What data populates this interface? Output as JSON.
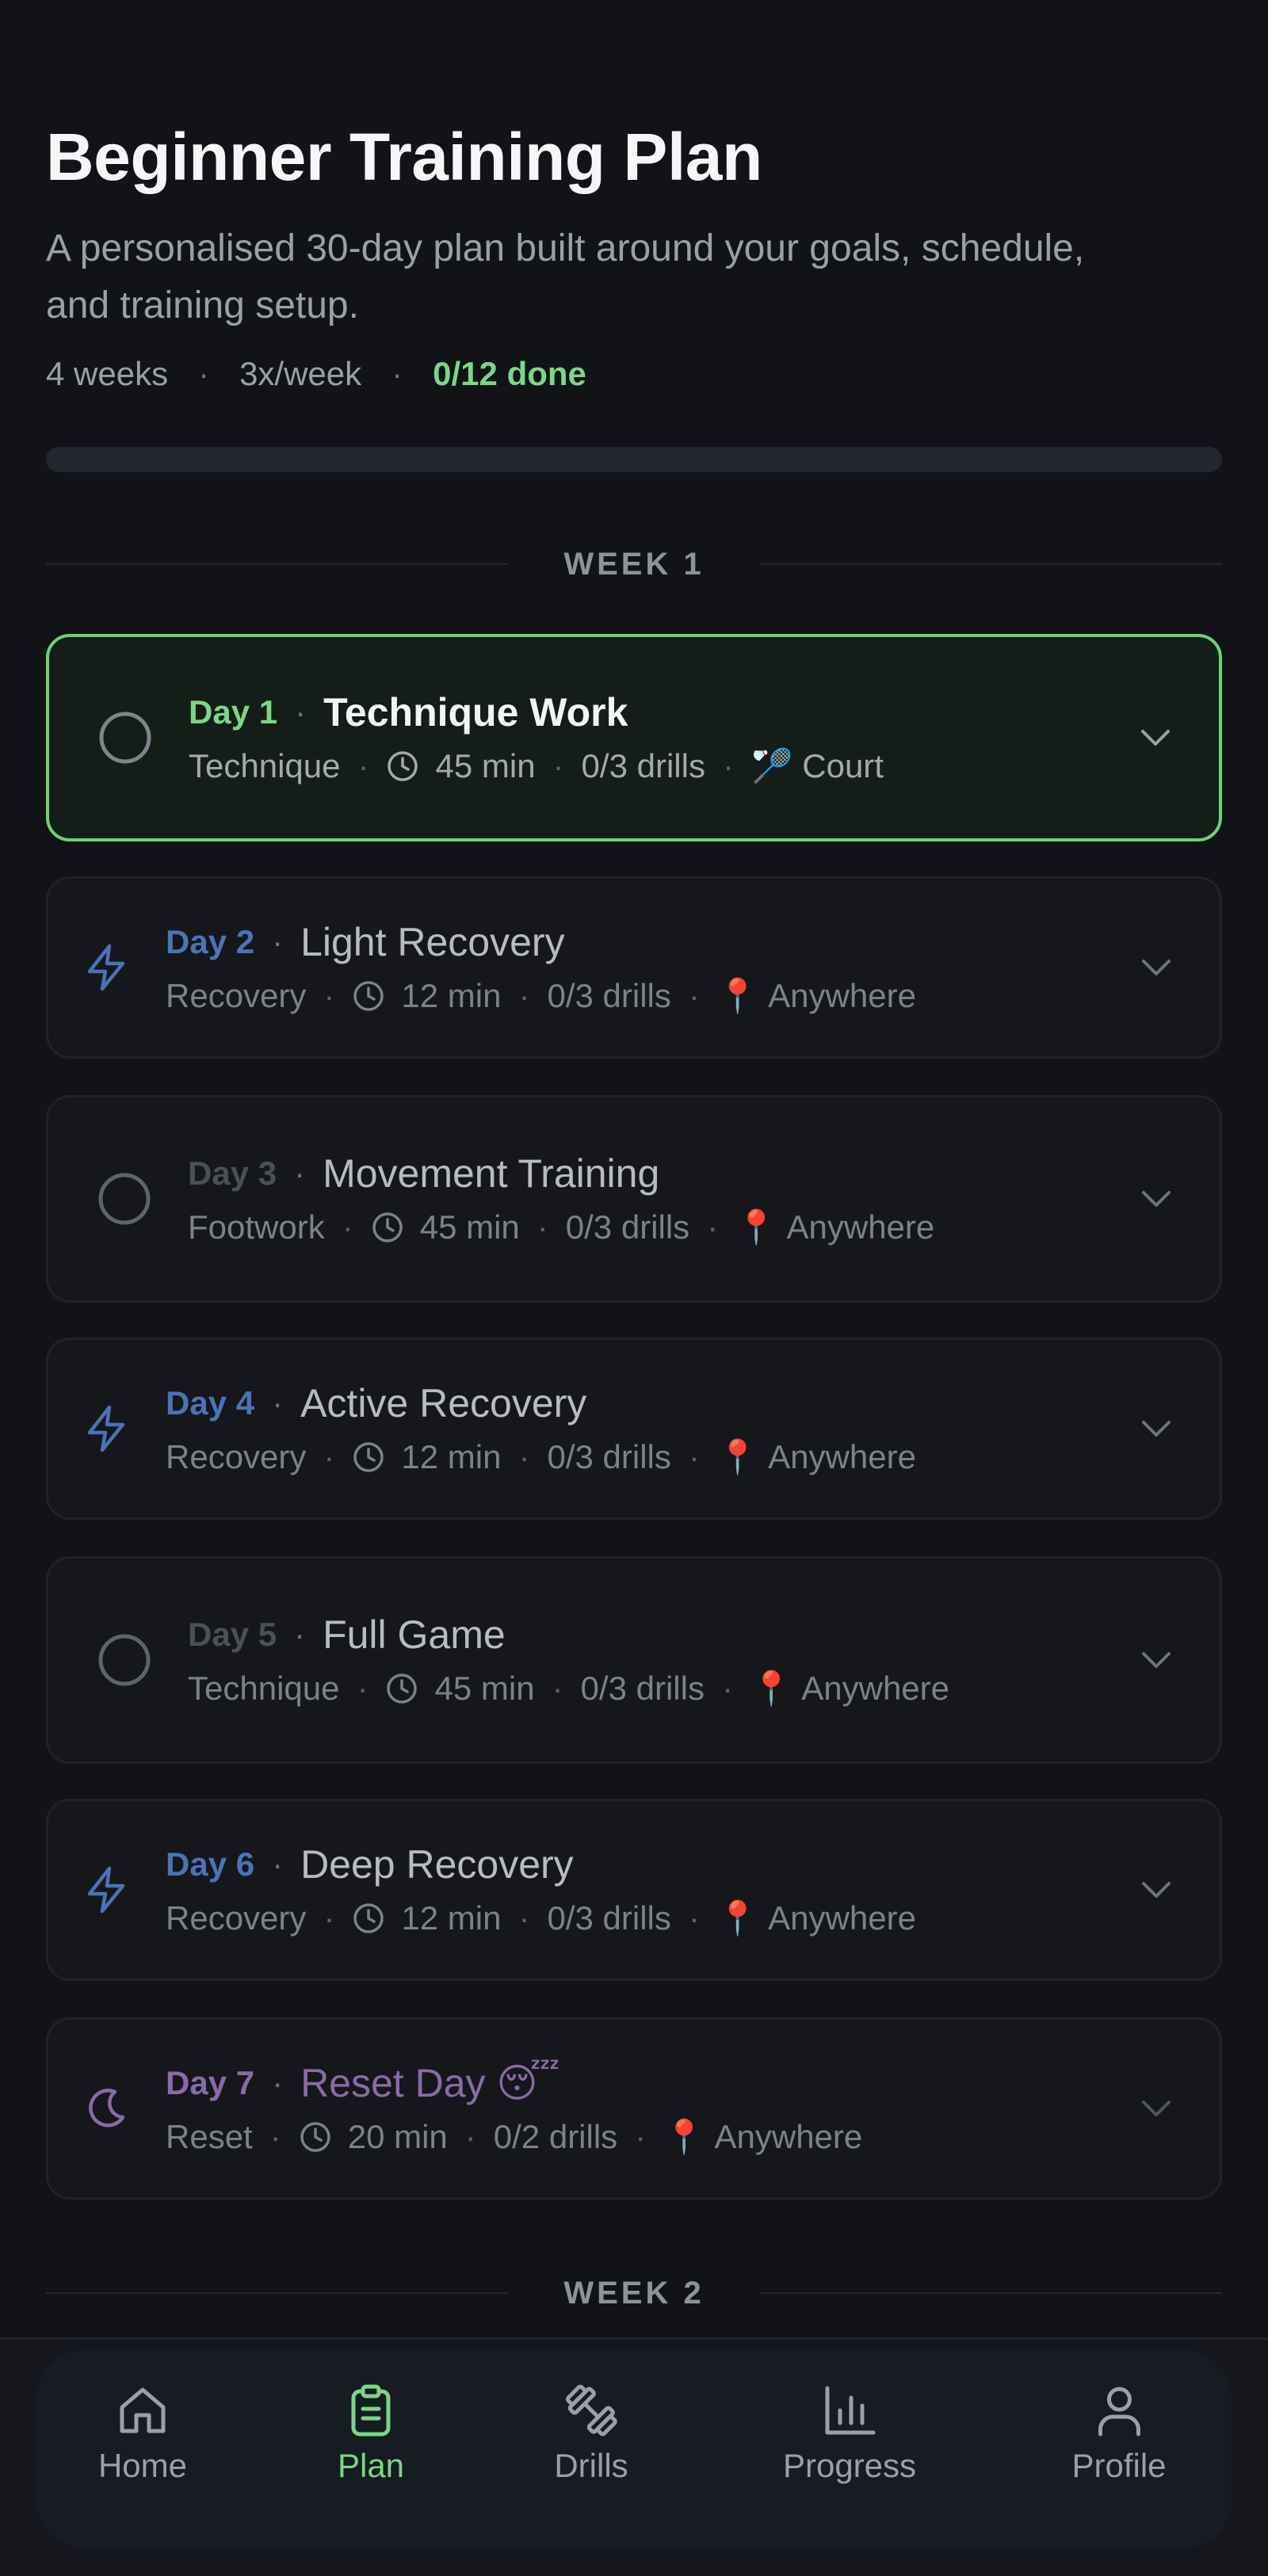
{
  "header": {
    "title": "Beginner Training Plan",
    "subtitle": "A personalised 30-day plan built around your goals, schedule, and training setup.",
    "meta": {
      "weeks": "4 weeks",
      "frequency": "3x/week",
      "done": "0/12 done"
    },
    "progress_fraction": 0
  },
  "weeks": [
    {
      "label": "WEEK 1",
      "days": [
        {
          "day": "Day 1",
          "title": "Technique Work",
          "type": "Technique",
          "duration": "45 min",
          "drills": "0/3 drills",
          "location_icon": "🏸",
          "location": "Court",
          "icon": "circle-icon",
          "active": true
        },
        {
          "day": "Day 2",
          "title": "Light Recovery",
          "type": "Recovery",
          "duration": "12 min",
          "drills": "0/3 drills",
          "location_icon": "📍",
          "location": "Anywhere",
          "icon": "lightning-icon"
        },
        {
          "day": "Day 3",
          "title": "Movement Training",
          "type": "Footwork",
          "duration": "45 min",
          "drills": "0/3 drills",
          "location_icon": "📍",
          "location": "Anywhere",
          "icon": "circle-icon"
        },
        {
          "day": "Day 4",
          "title": "Active Recovery",
          "type": "Recovery",
          "duration": "12 min",
          "drills": "0/3 drills",
          "location_icon": "📍",
          "location": "Anywhere",
          "icon": "lightning-icon"
        },
        {
          "day": "Day 5",
          "title": "Full Game",
          "type": "Technique",
          "duration": "45 min",
          "drills": "0/3 drills",
          "location_icon": "📍",
          "location": "Anywhere",
          "icon": "circle-icon"
        },
        {
          "day": "Day 6",
          "title": "Deep Recovery",
          "type": "Recovery",
          "duration": "12 min",
          "drills": "0/3 drills",
          "location_icon": "📍",
          "location": "Anywhere",
          "icon": "lightning-icon"
        },
        {
          "day": "Day 7",
          "title": "Reset Day 😴",
          "type": "Reset",
          "duration": "20 min",
          "drills": "0/2 drills",
          "location_icon": "📍",
          "location": "Anywhere",
          "icon": "moon-icon"
        }
      ]
    },
    {
      "label": "WEEK 2",
      "days": []
    }
  ],
  "nav": {
    "items": [
      {
        "label": "Home",
        "icon": "home-icon"
      },
      {
        "label": "Plan",
        "icon": "clipboard-icon",
        "selected": true
      },
      {
        "label": "Drills",
        "icon": "dumbbell-icon"
      },
      {
        "label": "Progress",
        "icon": "bar-chart-icon"
      },
      {
        "label": "Profile",
        "icon": "user-icon"
      }
    ]
  },
  "colors": {
    "background": "#111316",
    "accent_green": "#7ad787",
    "recovery_blue": "#4a73b8",
    "reset_purple": "#8a6aa6",
    "muted_text": "#7c828a"
  }
}
